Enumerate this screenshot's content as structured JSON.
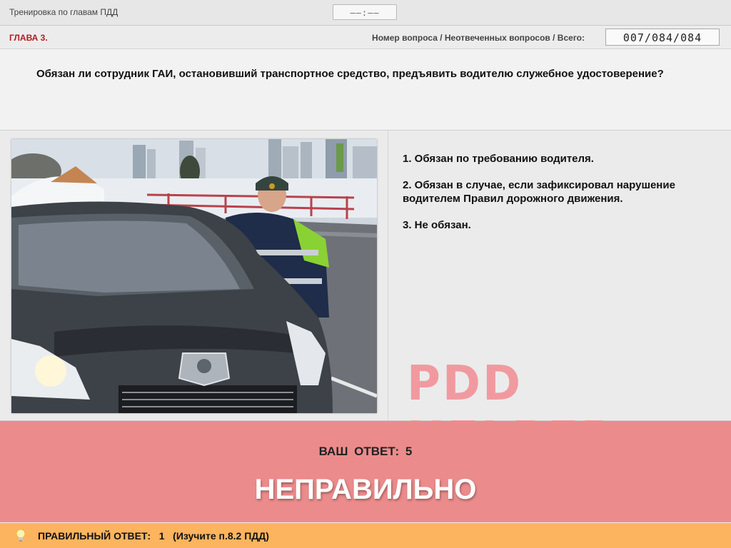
{
  "app": {
    "title": "Тренировка по главам ПДД",
    "timer": "––:––"
  },
  "chapter": {
    "label": "ГЛАВА 3.",
    "counter_label": "Номер вопроса / Неотвеченных вопросов / Всего:",
    "counter": "007/084/084"
  },
  "question": {
    "text": "Обязан ли сотрудник ГАИ, остановивший транспортное средство, предъявить водителю служебное удостоверение?"
  },
  "answers": [
    "1.  Обязан по требованию водителя.",
    "2.  Обязан в случае, если зафиксировал нарушение водителем Правил дорожного движения.",
    "3.  Не обязан."
  ],
  "watermark": "PDD HELPER",
  "result": {
    "your_answer": "ВАШ  ОТВЕТ:   5",
    "verdict": "НЕПРАВИЛЬНО",
    "color": "#ec8b8c"
  },
  "hint": {
    "text": "ПРАВИЛЬНЫЙ ОТВЕТ:   1   (Изучите п.8.2 ПДД)",
    "icon": "lightbulb-icon",
    "color": "#fdb45f"
  },
  "photo": {
    "icon": "traffic-police-photo"
  }
}
